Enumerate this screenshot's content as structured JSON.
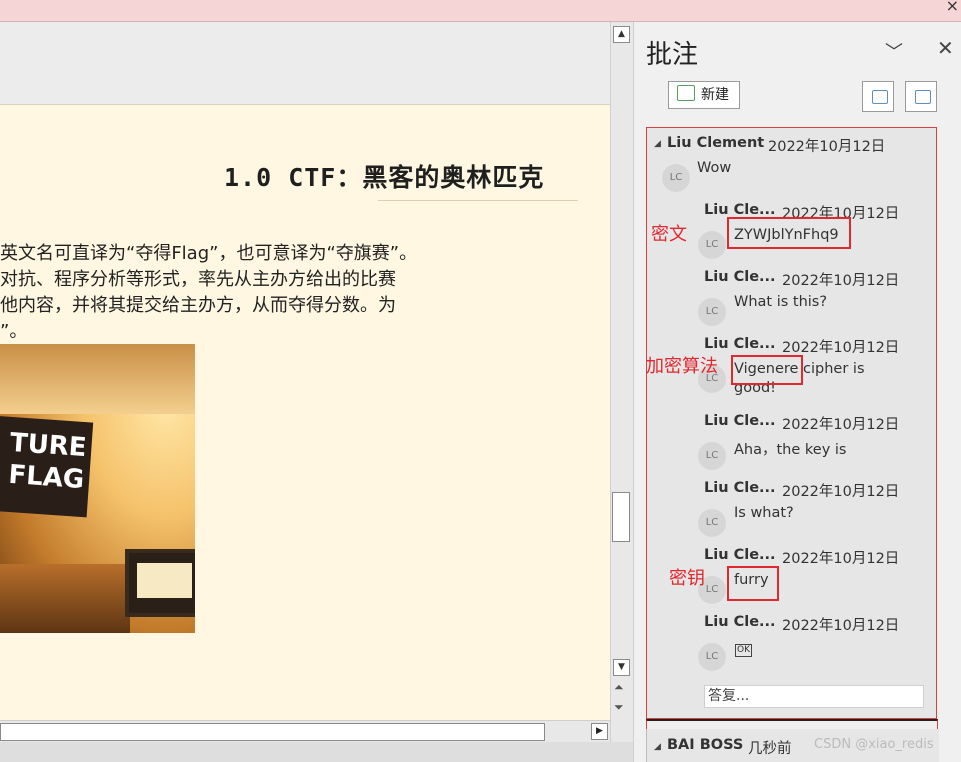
{
  "window": {
    "close_glyph": "×"
  },
  "document": {
    "title": "1.0  CTF：黑客的奥林匹克",
    "lines": [
      "英文名可直译为“夺得Flag”，也可意译为“夺旗赛”。",
      "对抗、程序分析等形式，率先从主办方给出的比赛",
      "他内容，并将其提交给主办方，从而夺得分数。为",
      "”。"
    ],
    "image_text": "TURE\nFLAG"
  },
  "pane": {
    "title": "批注",
    "new_label": "新建",
    "reply_placeholder": "答复...",
    "threads": [
      {
        "author": "Liu Clement",
        "date": "2022年10月12日",
        "text": "Wow",
        "avatar": "LC",
        "replies": [
          {
            "author": "Liu Cle...",
            "date": "2022年10月12日",
            "text": "ZYWJblYnFhq9",
            "avatar": "LC"
          },
          {
            "author": "Liu Cle...",
            "date": "2022年10月12日",
            "text": "What is this?",
            "avatar": "LC"
          },
          {
            "author": "Liu Cle...",
            "date": "2022年10月12日",
            "text": "Vigenere cipher is",
            "text2": "good!",
            "avatar": "LC"
          },
          {
            "author": "Liu Cle...",
            "date": "2022年10月12日",
            "text": "Aha，the key is",
            "avatar": "LC"
          },
          {
            "author": "Liu Cle...",
            "date": "2022年10月12日",
            "text": "Is what?",
            "avatar": "LC"
          },
          {
            "author": "Liu Cle...",
            "date": "2022年10月12日",
            "text": "furry",
            "avatar": "LC"
          },
          {
            "author": "Liu Cle...",
            "date": "2022年10月12日",
            "text": "OK",
            "avatar": "LC"
          }
        ]
      },
      {
        "author": "BAI BOSS",
        "date": "几秒前"
      }
    ]
  },
  "annotations": {
    "ciphertext": "密文",
    "algorithm": "加密算法",
    "key": "密钥"
  },
  "watermark": "CSDN @xiao_redis",
  "colors": {
    "annotation_red": "#e0282e",
    "page_bg": "#fff7e1",
    "topbar": "#f5d5d5"
  }
}
